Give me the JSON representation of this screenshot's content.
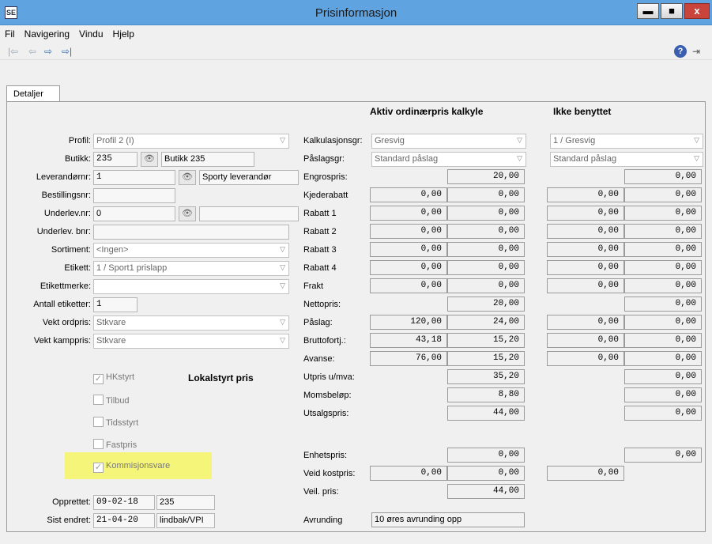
{
  "window": {
    "title": "Prisinformasjon",
    "app_icon": "SE",
    "minimize": "▬",
    "maximize": "■",
    "close": "x"
  },
  "menu": [
    "Fil",
    "Navigering",
    "Vindu",
    "Hjelp"
  ],
  "toolbar": {
    "first": "|⇦",
    "prev": "⇦",
    "next": "⇨",
    "last": "⇨|",
    "help": "?",
    "exit": "⇥"
  },
  "tabs": [
    "Detaljer"
  ],
  "headers": {
    "active": "Aktiv ordinærpris kalkyle",
    "unused": "Ikke benyttet",
    "local": "Lokalstyrt pris"
  },
  "left": {
    "profil_label": "Profil:",
    "profil": "Profil 2 (I)",
    "butikk_label": "Butikk:",
    "butikk_nr": "235",
    "butikk_navn": "Butikk 235",
    "lev_label": "Leverandørnr:",
    "lev_nr": "1",
    "lev_navn": "Sporty leverandør",
    "best_label": "Bestillingsnr:",
    "best": "",
    "underlev_label": "Underlev.nr:",
    "underlev": "0",
    "underlev_navn": "",
    "underbnr_label": "Underlev. bnr:",
    "underbnr": "",
    "sortiment_label": "Sortiment:",
    "sortiment": "<Ingen>",
    "etikett_label": "Etikett:",
    "etikett": "1 / Sport1 prislapp",
    "etikettmerke_label": "Etikettmerke:",
    "etikettmerke": "",
    "antall_label": "Antall etiketter:",
    "antall": "1",
    "vektord_label": "Vekt ordpris:",
    "vektord": "Stkvare",
    "vektkamp_label": "Vekt kamppris:",
    "vektkamp": "Stkvare",
    "opprettet_label": "Opprettet:",
    "opprettet_dato": "09-02-18",
    "opprettet_av": "235",
    "endret_label": "Sist endret:",
    "endret_dato": "21-04-20",
    "endret_av": "lindbak/VPI"
  },
  "checkboxes": [
    {
      "label": "HKstyrt",
      "checked": true
    },
    {
      "label": "Tilbud",
      "checked": false
    },
    {
      "label": "Tidsstyrt",
      "checked": false
    },
    {
      "label": "Fastpris",
      "checked": false
    },
    {
      "label": "Kommisjonsvare",
      "checked": true
    }
  ],
  "calc": {
    "kalk_label": "Kalkulasjonsgr:",
    "kalk": "Gresvig",
    "paslagsgr_label": "Påslagsgr:",
    "paslagsgr": "Standard påslag",
    "unused_kalk": "1 / Gresvig",
    "unused_paslagsgr": "Standard påslag",
    "rows": [
      {
        "label": "Engrospris:",
        "a": "",
        "b": "20,00",
        "c": "",
        "d": "0,00"
      },
      {
        "label": "Kjederabatt",
        "a": "0,00",
        "b": "0,00",
        "c": "0,00",
        "d": "0,00"
      },
      {
        "label": "Rabatt 1",
        "a": "0,00",
        "b": "0,00",
        "c": "0,00",
        "d": "0,00"
      },
      {
        "label": "Rabatt 2",
        "a": "0,00",
        "b": "0,00",
        "c": "0,00",
        "d": "0,00"
      },
      {
        "label": "Rabatt 3",
        "a": "0,00",
        "b": "0,00",
        "c": "0,00",
        "d": "0,00"
      },
      {
        "label": "Rabatt 4",
        "a": "0,00",
        "b": "0,00",
        "c": "0,00",
        "d": "0,00"
      },
      {
        "label": "Frakt",
        "a": "0,00",
        "b": "0,00",
        "c": "0,00",
        "d": "0,00"
      },
      {
        "label": "Nettopris:",
        "a": "",
        "b": "20,00",
        "c": "",
        "d": "0,00"
      },
      {
        "label": "Påslag:",
        "a": "120,00",
        "b": "24,00",
        "c": "0,00",
        "d": "0,00"
      },
      {
        "label": "Bruttofortj.:",
        "a": "43,18",
        "b": "15,20",
        "c": "0,00",
        "d": "0,00"
      },
      {
        "label": "Avanse:",
        "a": "76,00",
        "b": "15,20",
        "c": "0,00",
        "d": "0,00"
      },
      {
        "label": "Utpris u/mva:",
        "a": "",
        "b": "35,20",
        "c": "",
        "d": "0,00"
      },
      {
        "label": "Momsbeløp:",
        "a": "",
        "b": "8,80",
        "c": "",
        "d": "0,00"
      },
      {
        "label": "Utsalgspris:",
        "a": "",
        "b": "44,00",
        "c": "",
        "d": "0,00"
      }
    ],
    "enhet_label": "Enhetspris:",
    "enhet_b": "0,00",
    "enhet_d": "0,00",
    "veid_label": "Veid kostpris:",
    "veid_a": "0,00",
    "veid_b": "0,00",
    "veid_c": "0,00",
    "veil_label": "Veil. pris:",
    "veil_b": "44,00",
    "avrunding_label": "Avrunding",
    "avrunding": "10 øres avrunding opp"
  }
}
